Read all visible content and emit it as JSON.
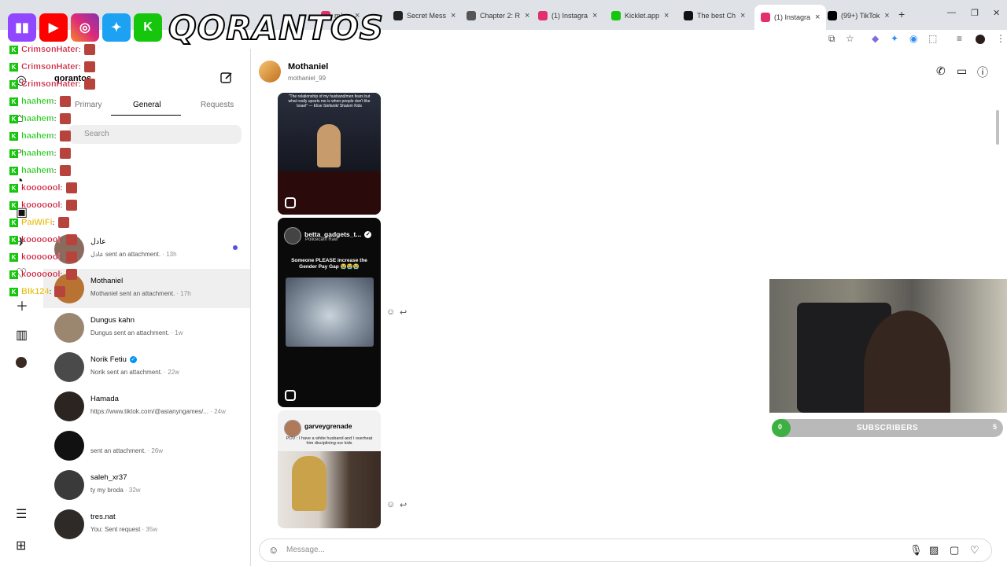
{
  "browser": {
    "tabs": [
      {
        "label": "m/po",
        "color": "#e1306c"
      },
      {
        "label": "Secret Mess",
        "color": "#222222"
      },
      {
        "label": "Chapter 2: R",
        "color": "#555555"
      },
      {
        "label": "(1) Instagra",
        "color": "#e1306c"
      },
      {
        "label": "Kicklet.app",
        "color": "#16c60c"
      },
      {
        "label": "The best Ch",
        "color": "#111111"
      },
      {
        "label": "(1) Instagra",
        "color": "#e1306c"
      },
      {
        "label": "(99+) TikTok",
        "color": "#000000"
      }
    ],
    "close_glyph": "×",
    "new_tab_glyph": "+"
  },
  "overlay": {
    "brand": "QORANTOS",
    "platforms": [
      "twitch-icon",
      "youtube-icon",
      "instagram-icon",
      "twitter-icon",
      "kick-icon"
    ],
    "chat": [
      {
        "name": "CrimsonHater",
        "sep": " :",
        "color": "#c8102e"
      },
      {
        "name": "CrimsonHater",
        "sep": " :",
        "color": "#c8102e"
      },
      {
        "name": "CrimsonHater",
        "sep": " :",
        "color": "#c8102e"
      },
      {
        "name": "haahem",
        "sep": " :",
        "color": "#16c60c"
      },
      {
        "name": "haahem",
        "sep": " :",
        "color": "#16c60c"
      },
      {
        "name": "haahem",
        "sep": " :",
        "color": "#16c60c"
      },
      {
        "name": "haahem",
        "sep": " :",
        "color": "#16c60c"
      },
      {
        "name": "haahem",
        "sep": " :",
        "color": "#16c60c"
      },
      {
        "name": "kooooool",
        "sep": " :",
        "color": "#c8102e"
      },
      {
        "name": "kooooool",
        "sep": " :",
        "color": "#c8102e"
      },
      {
        "name": "PaiWiFi",
        "sep": " :",
        "color": "#e6b800"
      },
      {
        "name": "kooooool",
        "sep": " :",
        "color": "#c8102e"
      },
      {
        "name": "kooooool",
        "sep": " :",
        "color": "#c8102e"
      },
      {
        "name": "kooooool",
        "sep": " :",
        "color": "#c8102e"
      },
      {
        "name": "Blk124",
        "sep": " :",
        "color": "#e6b800"
      }
    ]
  },
  "sidebar": {
    "username": "qorantos",
    "tabs": [
      {
        "label": "Primary"
      },
      {
        "label": "General"
      },
      {
        "label": "Requests"
      }
    ],
    "search_placeholder": "Search",
    "conversations": [
      {
        "name": "عادل",
        "preview": "عادل sent an attachment.",
        "time": " · 13h",
        "unread": true,
        "avatar": "#8a6b5e"
      },
      {
        "name": "Mothaniel",
        "preview": "Mothaniel sent an attachment.",
        "time": " · 17h",
        "unread": false,
        "avatar": "#b87333"
      },
      {
        "name": "Dungus kahn",
        "preview": "Dungus sent an attachment.",
        "time": " · 1w",
        "unread": false,
        "avatar": "#9b8670"
      },
      {
        "name": "Norik Fetiu",
        "preview": "Norik sent an attachment.",
        "time": " · 22w",
        "unread": false,
        "avatar": "#4a4a4a",
        "verified": true
      },
      {
        "name": "Hamada",
        "preview": "https://www.tiktok.com/@asianyngames/...",
        "time": " · 24w",
        "unread": false,
        "avatar": "#2b2420"
      },
      {
        "name": "",
        "preview": " sent an attachment.",
        "time": " · 26w",
        "unread": false,
        "avatar": "#111111"
      },
      {
        "name": "saleh_xr37",
        "preview": "ty my broda",
        "time": " · 32w",
        "unread": false,
        "avatar": "#3a3a3a"
      },
      {
        "name": "tres.nat",
        "preview": "You: Sent request",
        "time": " · 35w",
        "unread": false,
        "avatar": "#2e2a28"
      }
    ]
  },
  "chat": {
    "name": "Mothaniel",
    "handle": "mothaniel_99",
    "reels": [
      {
        "account": "",
        "caption": "\"The relationship of my husband/men fears but what really upsets me is when people don't like Israel\" — Elise Stefanik/ Shalom Kids"
      },
      {
        "account": "betta_gadgets_t...",
        "sub": "Policecam Raw",
        "caption": "Someone PLEASE increase the Gender Pay Gap 😭😭😭"
      },
      {
        "account": "garveygrenade",
        "caption": "POV : I have a white husband and I overheat him disciplining our kids"
      }
    ],
    "composer_placeholder": "Message..."
  },
  "webcam": {
    "subs_label": "SUBSCRIBERS",
    "current": "0",
    "goal": "5",
    "progress_fraction": 0.0
  }
}
